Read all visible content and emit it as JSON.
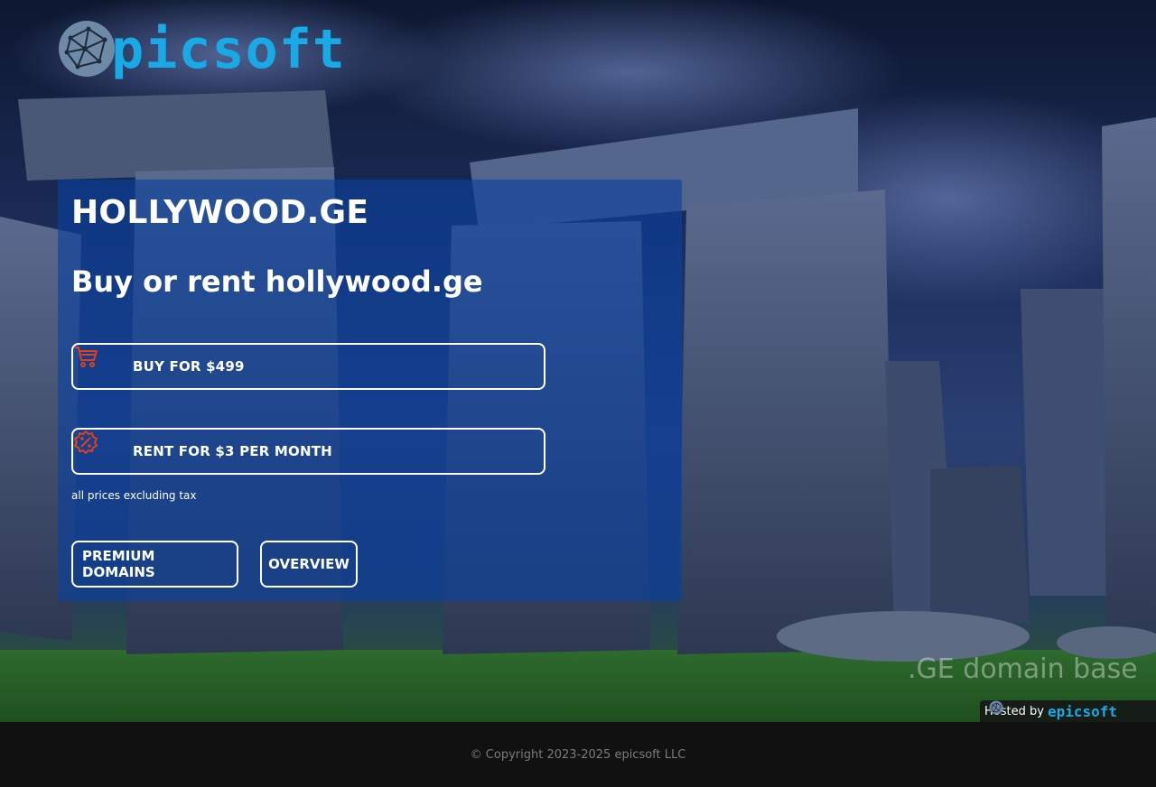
{
  "brand": {
    "name": "epicsoft",
    "accent_color": "#19a9e6",
    "icon": "globe-network-icon"
  },
  "panel": {
    "domain_title": "HOLLYWOOD.GE",
    "subtitle": "Buy or rent hollywood.ge",
    "buy": {
      "label": "BUY FOR $499",
      "icon": "shopping-cart-icon"
    },
    "rent": {
      "label": "RENT FOR $3 PER MONTH",
      "icon": "rent-badge-icon"
    },
    "tax_note": "all prices excluding tax",
    "nav": {
      "premium_label": "PREMIUM DOMAINS",
      "overview_label": "OVERVIEW"
    },
    "icon_color": "#e0401a"
  },
  "watermark": ".GE domain base",
  "hosted_by": {
    "label": "Hosted by",
    "brand": "epicsoft"
  },
  "footer": {
    "copyright": "© Copyright 2023-2025 epicsoft LLC"
  }
}
